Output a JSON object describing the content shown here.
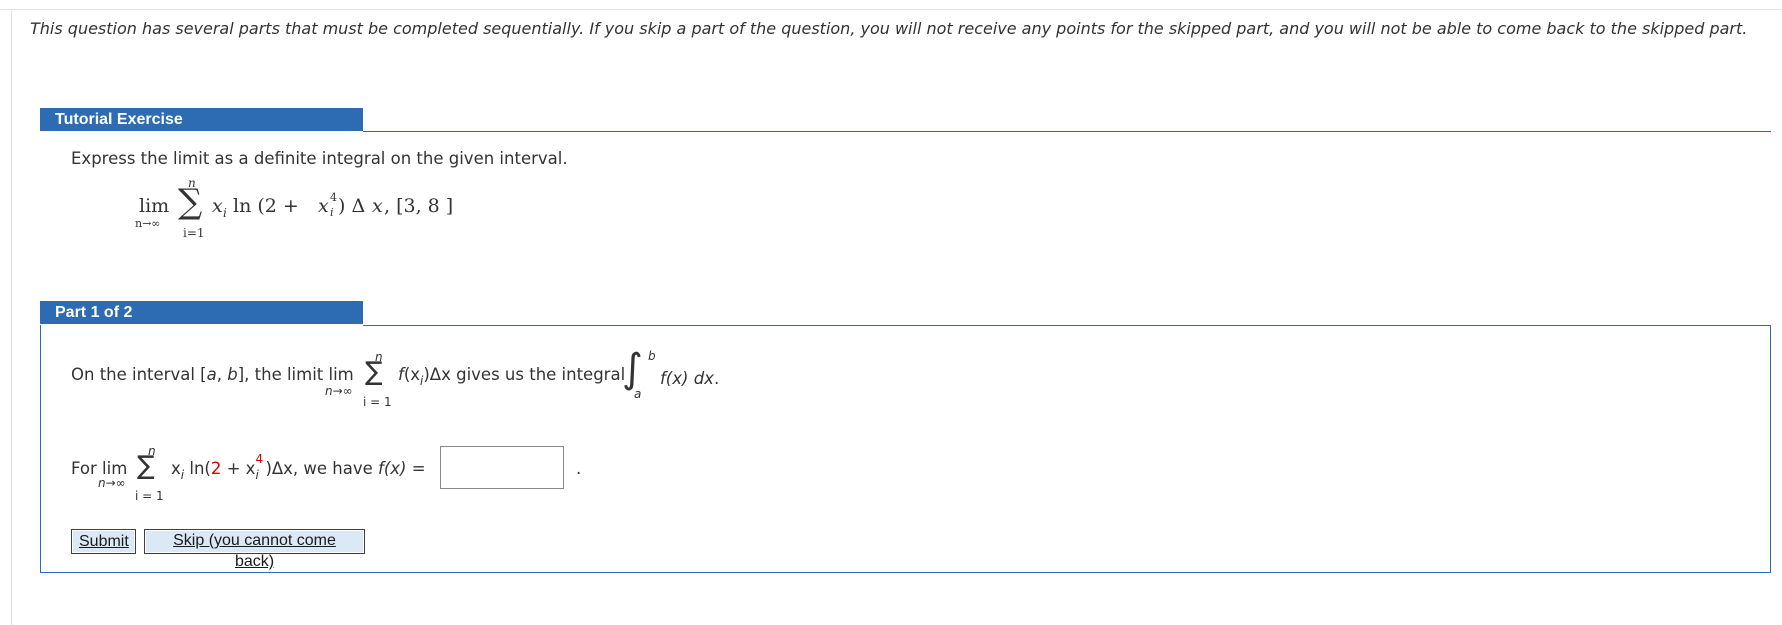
{
  "intro_text": "This question has several parts that must be completed sequentially. If you skip a part of the question, you will not receive any points for the skipped part, and you will not be able to come back to the skipped part.",
  "tutorial": {
    "header": "Tutorial Exercise",
    "prompt": "Express the limit as a definite integral on the given interval.",
    "formula": {
      "lim": "lim",
      "lim_sub": "n→∞",
      "sigma": "∑",
      "upper": "n",
      "lower": "i=1",
      "xi": "x",
      "xi_sub": "i",
      "ln_open": "ln (2 + ",
      "x4": "x",
      "x4_sup": "4",
      "x4_sub": "i",
      "tail": ") Δ",
      "dx_var": "x",
      "interval": ",   [3, 8 ]"
    }
  },
  "part": {
    "header": "Part 1 of 2",
    "line1": {
      "pre": "On the interval [",
      "a": "a",
      "comma": ", ",
      "b": "b",
      "post": "], the limit ",
      "lim": "lim",
      "lim_sub": "n→∞",
      "sigma": "∑",
      "upper": "n",
      "lower": "i = 1",
      "fx": "f",
      "fx_open": "(x",
      "fx_sub": "i",
      "fx_close": ")Δx",
      "gives": " gives us the integral",
      "int_sign": "∫",
      "int_upper": "b",
      "int_lower": "a",
      "integrand": "f(x) dx",
      "dot": "."
    },
    "line2": {
      "pre": "For ",
      "lim": "lim",
      "lim_sub": "n→∞",
      "sigma": "∑",
      "upper": "n",
      "lower": "i = 1",
      "xi": "x",
      "xi_sub": "i",
      "ln_open": " ln(",
      "two": "2",
      "plus": " + x",
      "x_sub": "i",
      "x_sup": "4",
      "close": ")Δx, we have ",
      "fx": "f(x)",
      "eq": " = ",
      "period": "."
    },
    "answer_value": "",
    "submit_label": "Submit",
    "skip_label": "Skip (you cannot come back)"
  },
  "colors": {
    "header_bg": "#2d6cb2",
    "button_bg": "#dbe9f7",
    "red": "#d40000"
  }
}
